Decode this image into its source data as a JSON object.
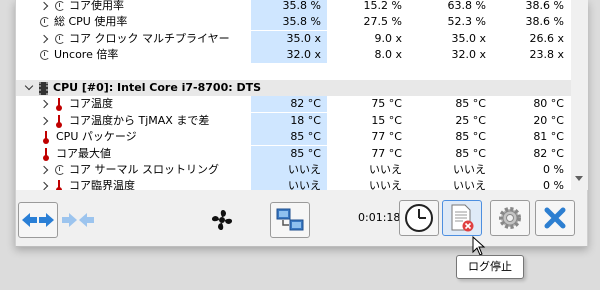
{
  "rows": [
    {
      "type": "sensor",
      "icon": "clock-icon",
      "expand": true,
      "label": "コア使用率",
      "v1": "35.8 %",
      "v2": "15.2 %",
      "v3": "63.8 %",
      "v4": "38.6 %"
    },
    {
      "type": "sensor",
      "icon": "clock-icon",
      "expand": false,
      "label": "総 CPU 使用率",
      "v1": "35.8 %",
      "v2": "27.5 %",
      "v3": "52.3 %",
      "v4": "38.6 %"
    },
    {
      "type": "sensor",
      "icon": "clock-icon",
      "expand": true,
      "label": "コア クロック マルチプライヤー",
      "v1": "35.0 x",
      "v2": "9.0 x",
      "v3": "35.0 x",
      "v4": "26.6 x"
    },
    {
      "type": "sensor",
      "icon": "clock-icon",
      "expand": false,
      "label": "Uncore 倍率",
      "v1": "32.0 x",
      "v2": "8.0 x",
      "v3": "32.0 x",
      "v4": "23.8 x"
    },
    {
      "type": "blank"
    },
    {
      "type": "group",
      "label": "CPU [#0]: Intel Core i7-8700: DTS"
    },
    {
      "type": "sensor",
      "icon": "thermometer-icon",
      "expand": true,
      "label": "コア温度",
      "v1": "82 °C",
      "v2": "75 °C",
      "v3": "85 °C",
      "v4": "80 °C"
    },
    {
      "type": "sensor",
      "icon": "thermometer-icon",
      "expand": true,
      "label": "コア温度から TjMAX まで差",
      "v1": "18 °C",
      "v2": "15 °C",
      "v3": "25 °C",
      "v4": "20 °C"
    },
    {
      "type": "sensor",
      "icon": "thermometer-icon",
      "expand": false,
      "label": "CPU パッケージ",
      "v1": "85 °C",
      "v2": "77 °C",
      "v3": "85 °C",
      "v4": "81 °C"
    },
    {
      "type": "sensor",
      "icon": "thermometer-icon",
      "expand": false,
      "label": "コア最大値",
      "v1": "85 °C",
      "v2": "77 °C",
      "v3": "85 °C",
      "v4": "82 °C"
    },
    {
      "type": "sensor",
      "icon": "clock-icon",
      "expand": true,
      "label": "コア サーマル スロットリング",
      "v1": "いいえ",
      "v2": "いいえ",
      "v3": "いいえ",
      "v4": "0 %"
    },
    {
      "type": "sensor",
      "icon": "thermometer-icon",
      "expand": true,
      "label": "コア臨界温度",
      "v1": "いいえ",
      "v2": "いいえ",
      "v3": "いいえ",
      "v4": "0 %"
    }
  ],
  "toolbar": {
    "timer": "0:01:18",
    "tooltip": "ログ停止"
  }
}
